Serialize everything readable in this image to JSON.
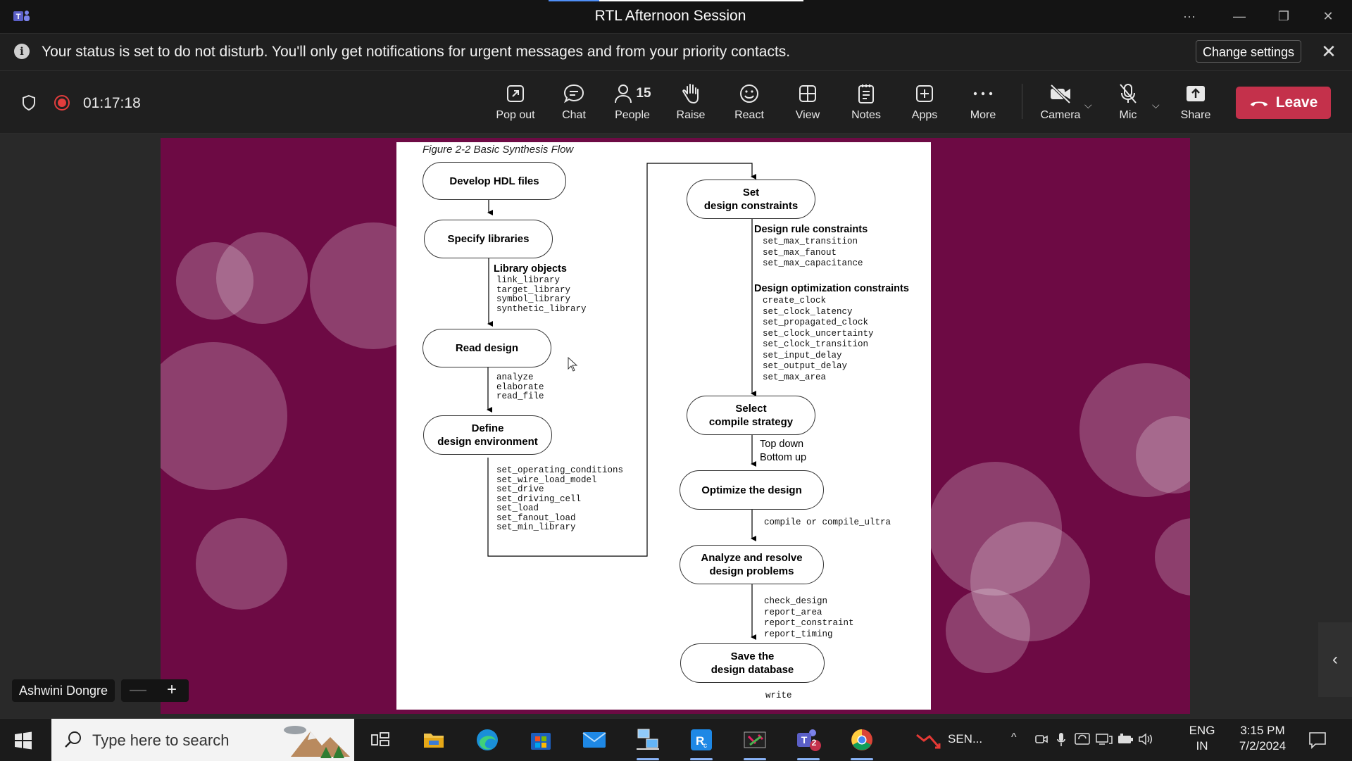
{
  "window": {
    "title": "RTL Afternoon Session"
  },
  "banner": {
    "text": "Your status is set to do not disturb. You'll only get notifications for urgent messages and from your priority contacts.",
    "action_label": "Change settings"
  },
  "meeting": {
    "timer": "01:17:18"
  },
  "toolbar": {
    "pop_out": "Pop out",
    "chat": "Chat",
    "people": "People",
    "people_count": "15",
    "raise": "Raise",
    "react": "React",
    "view": "View",
    "notes": "Notes",
    "apps": "Apps",
    "more": "More",
    "camera": "Camera",
    "mic": "Mic",
    "share": "Share",
    "leave": "Leave",
    "leave_color": "#c4314b"
  },
  "slide": {
    "caption": "Figure 2-2    Basic Synthesis Flow",
    "left_nodes": {
      "develop": "Develop HDL files",
      "specify": "Specify libraries",
      "read": "Read design",
      "define": "Define\ndesign environment"
    },
    "library_objects_title": "Library objects",
    "library_objects": "link_library\ntarget_library\nsymbol_library\nsynthetic_library",
    "read_cmds": "analyze\nelaborate\nread_file",
    "env_cmds": "set_operating_conditions\nset_wire_load_model\nset_drive\nset_driving_cell\nset_load\nset_fanout_load\nset_min_library",
    "right_nodes": {
      "constraints": "Set\ndesign constraints",
      "strategy": "Select\ncompile strategy",
      "optimize": "Optimize the design",
      "analyze": "Analyze and resolve\ndesign problems",
      "save": "Save the\ndesign database"
    },
    "rule_title": "Design rule constraints",
    "rule_cmds": "set_max_transition\nset_max_fanout\nset_max_capacitance",
    "opt_title": "Design optimization constraints",
    "opt_cmds": "create_clock\nset_clock_latency\nset_propagated_clock\nset_clock_uncertainty\nset_clock_transition\nset_input_delay\nset_output_delay\nset_max_area",
    "strategy_opts": "Top down\nBottom up",
    "compile_cmds": "compile or compile_ultra",
    "check_cmds": "check_design\nreport_area\nreport_constraint\nreport_timing",
    "write_cmd": "write"
  },
  "presenter": {
    "name": "Ashwini Dongre",
    "zoom_out": "—",
    "zoom_in": "+"
  },
  "taskbar": {
    "search_placeholder": "Type here to search",
    "app_label": "SEN...",
    "teams_badge": "2",
    "lang_top": "ENG",
    "lang_bottom": "IN",
    "time": "3:15 PM",
    "date": "7/2/2024"
  }
}
